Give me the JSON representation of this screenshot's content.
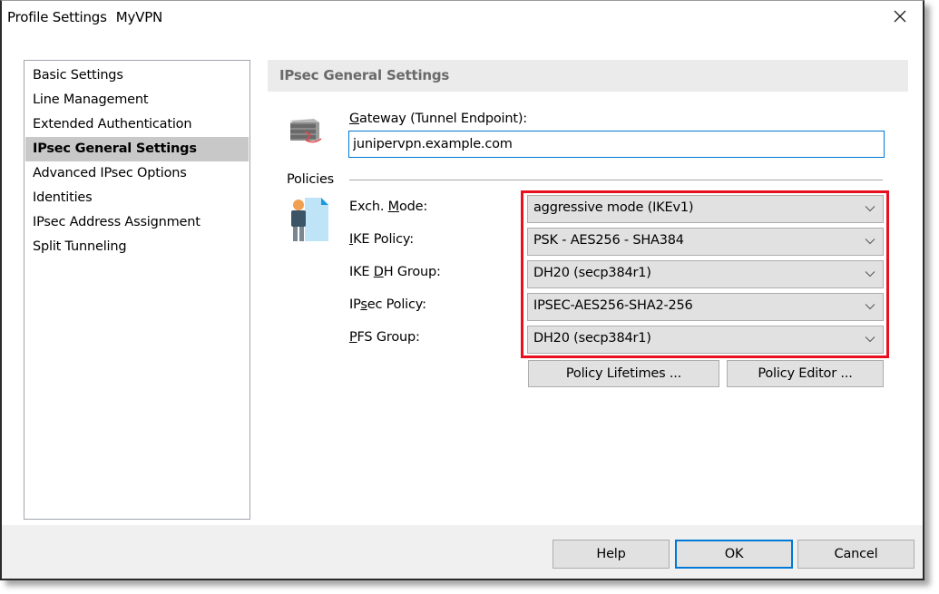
{
  "window": {
    "title": "Profile Settings",
    "profile_name": "MyVPN",
    "close_label": "Close"
  },
  "sidebar": {
    "items": [
      {
        "label": "Basic Settings",
        "active": false
      },
      {
        "label": "Line Management",
        "active": false
      },
      {
        "label": "Extended Authentication",
        "active": false
      },
      {
        "label": "IPsec General Settings",
        "active": true
      },
      {
        "label": "Advanced IPsec Options",
        "active": false
      },
      {
        "label": "Identities",
        "active": false
      },
      {
        "label": "IPsec Address Assignment",
        "active": false
      },
      {
        "label": "Split Tunneling",
        "active": false
      }
    ]
  },
  "panel": {
    "header": "IPsec General Settings",
    "gateway": {
      "label_access_key": "G",
      "label_rest": "ateway (Tunnel Endpoint):",
      "value": "junipervpn.example.com",
      "icon": "gateway-server-icon"
    },
    "policies": {
      "section_label": "Policies",
      "icon": "user-policy-icon",
      "highlight_color": "#e8101e",
      "fields": [
        {
          "label_pre": "Exch. ",
          "label_key": "M",
          "label_post": "ode:",
          "value": "aggressive mode (IKEv1)"
        },
        {
          "label_pre": "",
          "label_key": "I",
          "label_post": "KE Policy:",
          "value": "PSK - AES256 - SHA384"
        },
        {
          "label_pre": "IKE ",
          "label_key": "D",
          "label_post": "H Group:",
          "value": "DH20 (secp384r1)"
        },
        {
          "label_pre": "IP",
          "label_key": "s",
          "label_post": "ec Policy:",
          "value": "IPSEC-AES256-SHA2-256"
        },
        {
          "label_pre": "",
          "label_key": "P",
          "label_post": "FS Group:",
          "value": "DH20 (secp384r1)"
        }
      ],
      "buttons": {
        "lifetimes": "Policy Lifetimes ...",
        "editor": "Policy Editor ..."
      }
    }
  },
  "footer": {
    "help": "Help",
    "ok": "OK",
    "cancel": "Cancel",
    "accent_color": "#0078d7"
  }
}
